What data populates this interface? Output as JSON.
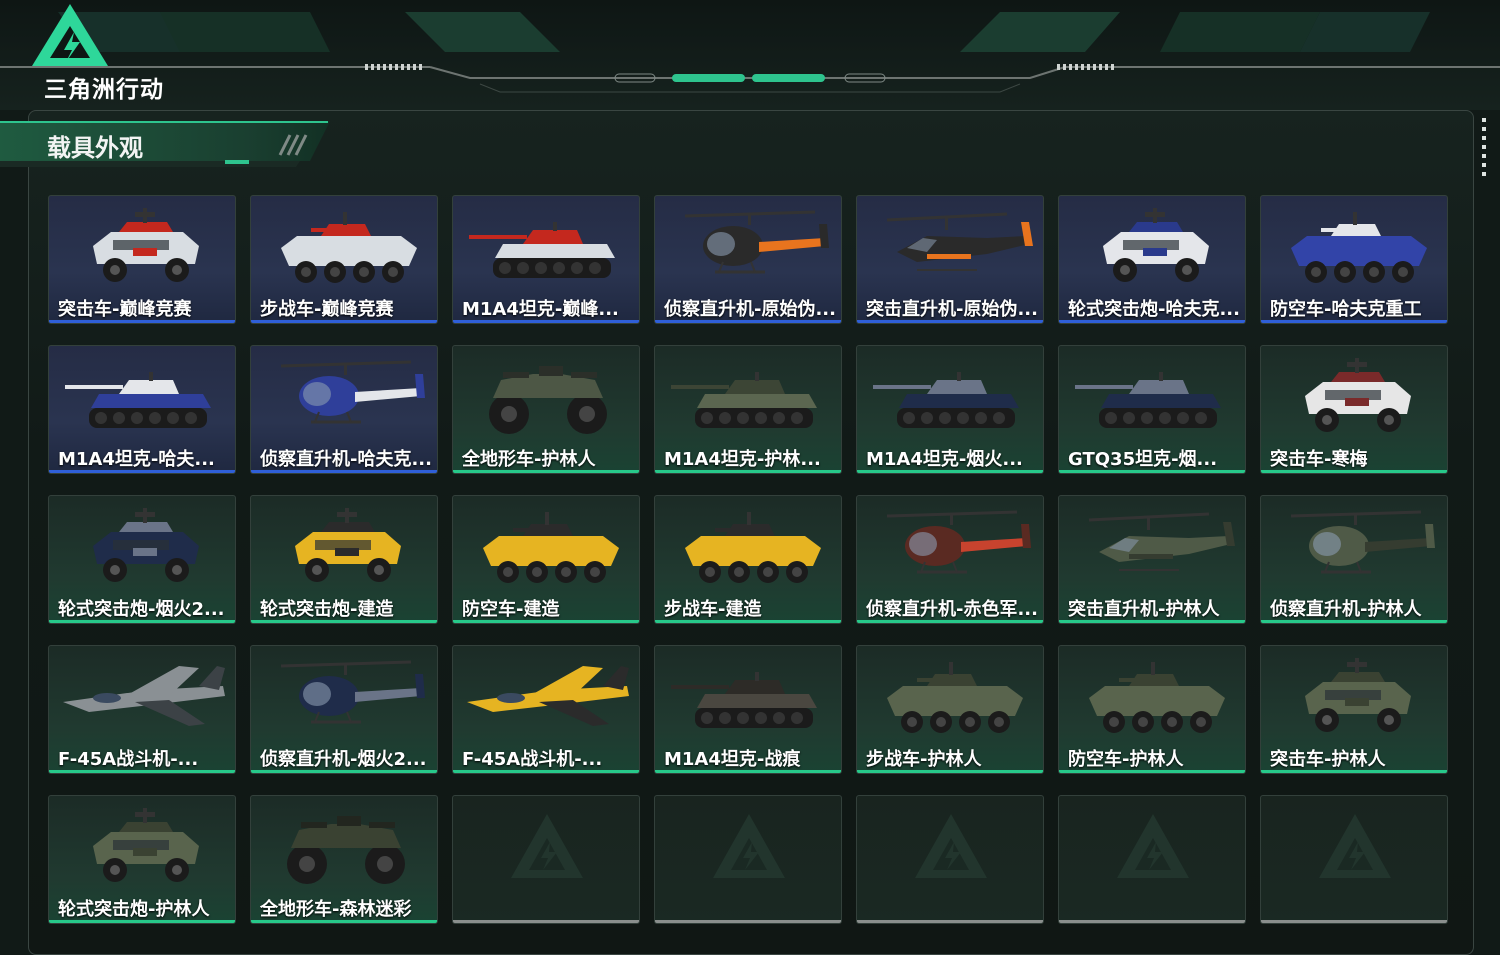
{
  "app": {
    "logo_text": "三角洲行动",
    "logo_icon": "delta-triangle-logo-icon"
  },
  "section": {
    "title": "载具外观"
  },
  "colors": {
    "accent_green": "#27c98a",
    "rarity_blue": "#2f5fd8",
    "empty_gray": "#8a8f8d"
  },
  "skins": [
    {
      "label": "突击车-巅峰竞赛",
      "rarity": "blue",
      "vehicle": "assault-car",
      "palette": [
        "#d8dde2",
        "#c4281e"
      ]
    },
    {
      "label": "步战车-巅峰竞赛",
      "rarity": "blue",
      "vehicle": "ifv",
      "palette": [
        "#d8dde2",
        "#c4281e"
      ]
    },
    {
      "label": "M1A4坦克-巅峰...",
      "rarity": "blue",
      "vehicle": "tank",
      "palette": [
        "#d8dde2",
        "#c4281e"
      ]
    },
    {
      "label": "侦察直升机-原始伪...",
      "rarity": "blue",
      "vehicle": "scout-heli",
      "palette": [
        "#2a2a2a",
        "#e8741e"
      ]
    },
    {
      "label": "突击直升机-原始伪...",
      "rarity": "blue",
      "vehicle": "attack-heli",
      "palette": [
        "#2a2a2a",
        "#e8741e"
      ]
    },
    {
      "label": "轮式突击炮-哈夫克...",
      "rarity": "blue",
      "vehicle": "assault-car",
      "palette": [
        "#e4e6ea",
        "#2a3a8c"
      ]
    },
    {
      "label": "防空车-哈夫克重工",
      "rarity": "blue",
      "vehicle": "ifv",
      "palette": [
        "#3244a8",
        "#e4e6ea"
      ]
    },
    {
      "label": "M1A4坦克-哈夫...",
      "rarity": "blue",
      "vehicle": "tank",
      "palette": [
        "#2f3f9a",
        "#e4e6ea"
      ]
    },
    {
      "label": "侦察直升机-哈夫克...",
      "rarity": "blue",
      "vehicle": "scout-heli",
      "palette": [
        "#2f3f9a",
        "#e4e6ea"
      ]
    },
    {
      "label": "全地形车-护林人",
      "rarity": "green",
      "vehicle": "atv",
      "palette": [
        "#4d5745",
        "#2b2f29"
      ]
    },
    {
      "label": "M1A4坦克-护林...",
      "rarity": "green",
      "vehicle": "tank",
      "palette": [
        "#5b6650",
        "#3c4535"
      ]
    },
    {
      "label": "M1A4坦克-烟火...",
      "rarity": "green",
      "vehicle": "tank",
      "palette": [
        "#1f2c4a",
        "#6a7488"
      ]
    },
    {
      "label": "GTQ35坦克-烟...",
      "rarity": "green",
      "vehicle": "tank",
      "palette": [
        "#1f2c4a",
        "#6a7488"
      ]
    },
    {
      "label": "突击车-寒梅",
      "rarity": "green",
      "vehicle": "assault-car",
      "palette": [
        "#e6e6e6",
        "#7a2a2a"
      ]
    },
    {
      "label": "轮式突击炮-烟火2...",
      "rarity": "green",
      "vehicle": "assault-car",
      "palette": [
        "#1f2c4a",
        "#6a7488"
      ]
    },
    {
      "label": "轮式突击炮-建造",
      "rarity": "green",
      "vehicle": "assault-car",
      "palette": [
        "#e6b422",
        "#2b2b2b"
      ]
    },
    {
      "label": "防空车-建造",
      "rarity": "green",
      "vehicle": "ifv",
      "palette": [
        "#e6b422",
        "#2b2b2b"
      ]
    },
    {
      "label": "步战车-建造",
      "rarity": "green",
      "vehicle": "ifv",
      "palette": [
        "#e6b422",
        "#2b2b2b"
      ]
    },
    {
      "label": "侦察直升机-赤色军...",
      "rarity": "green",
      "vehicle": "scout-heli",
      "palette": [
        "#5a2a22",
        "#c8432e"
      ]
    },
    {
      "label": "突击直升机-护林人",
      "rarity": "green",
      "vehicle": "attack-heli",
      "palette": [
        "#4f5a47",
        "#353c30"
      ]
    },
    {
      "label": "侦察直升机-护林人",
      "rarity": "green",
      "vehicle": "scout-heli",
      "palette": [
        "#4f5a47",
        "#353c30"
      ]
    },
    {
      "label": "F-45A战斗机-...",
      "rarity": "green",
      "vehicle": "jet",
      "palette": [
        "#8a9094",
        "#3c4246"
      ]
    },
    {
      "label": "侦察直升机-烟火2...",
      "rarity": "green",
      "vehicle": "scout-heli",
      "palette": [
        "#1f2c4a",
        "#6a7488"
      ]
    },
    {
      "label": "F-45A战斗机-...",
      "rarity": "green",
      "vehicle": "jet",
      "palette": [
        "#e6b422",
        "#2b2b2b"
      ]
    },
    {
      "label": "M1A4坦克-战痕",
      "rarity": "green",
      "vehicle": "tank",
      "palette": [
        "#4a4740",
        "#2d2b27"
      ]
    },
    {
      "label": "步战车-护林人",
      "rarity": "green",
      "vehicle": "ifv",
      "palette": [
        "#59644d",
        "#3a4232"
      ]
    },
    {
      "label": "防空车-护林人",
      "rarity": "green",
      "vehicle": "ifv",
      "palette": [
        "#59644d",
        "#3a4232"
      ]
    },
    {
      "label": "突击车-护林人",
      "rarity": "green",
      "vehicle": "assault-car",
      "palette": [
        "#59644d",
        "#3a4232"
      ]
    },
    {
      "label": "轮式突击炮-护林人",
      "rarity": "green",
      "vehicle": "assault-car",
      "palette": [
        "#59644d",
        "#3a4232"
      ]
    },
    {
      "label": "全地形车-森林迷彩",
      "rarity": "green",
      "vehicle": "atv",
      "palette": [
        "#3a4232",
        "#22261f"
      ]
    },
    {
      "label": "",
      "rarity": "empty",
      "vehicle": "none",
      "palette": []
    },
    {
      "label": "",
      "rarity": "empty",
      "vehicle": "none",
      "palette": []
    },
    {
      "label": "",
      "rarity": "empty",
      "vehicle": "none",
      "palette": []
    },
    {
      "label": "",
      "rarity": "empty",
      "vehicle": "none",
      "palette": []
    },
    {
      "label": "",
      "rarity": "empty",
      "vehicle": "none",
      "palette": []
    }
  ]
}
